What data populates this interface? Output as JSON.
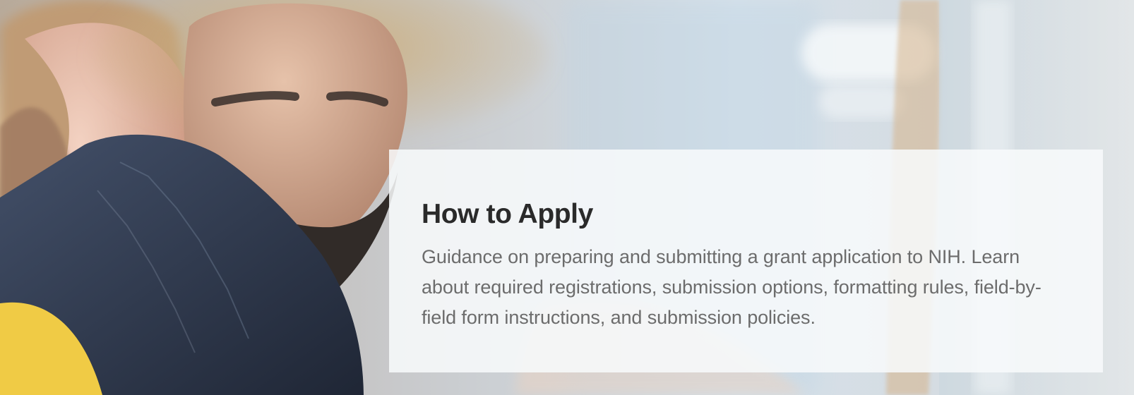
{
  "hero": {
    "title": "How to Apply",
    "description": "Guidance on preparing and submitting a grant application to NIH. Learn about required registrations, submission options, formatting rules, field-by-field form instructions, and submission policies."
  },
  "colors": {
    "panel_background": "#f8fafb",
    "title_text": "#2a2a2a",
    "body_text": "#6c6c6c"
  }
}
